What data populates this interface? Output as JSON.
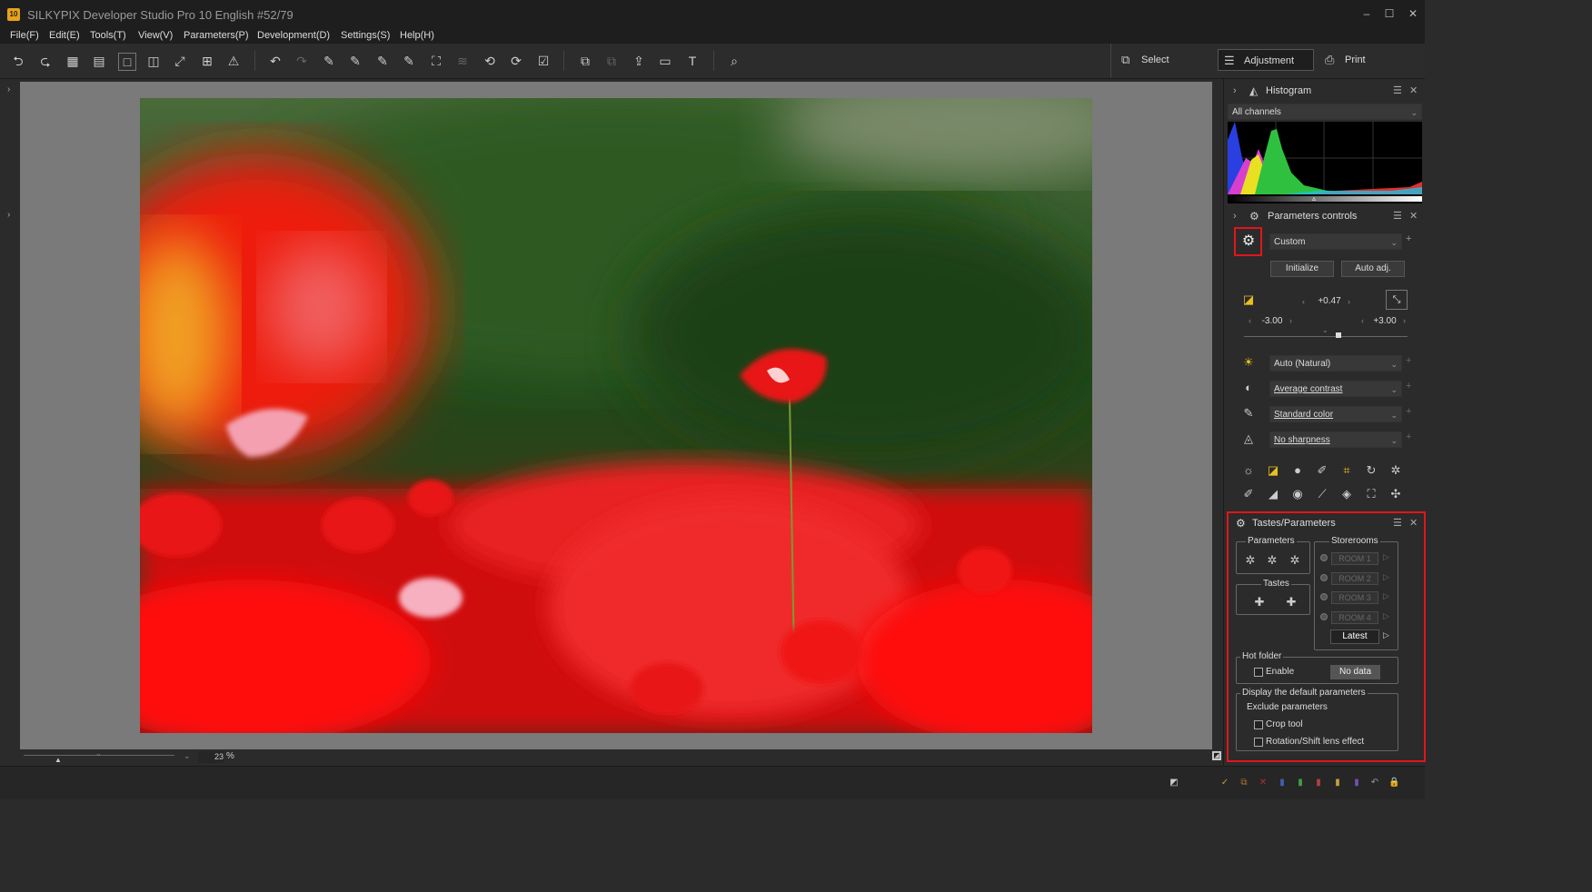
{
  "window": {
    "logo_text": "10",
    "title": "SILKYPIX Developer Studio Pro 10 English   #52/79",
    "minimize": "–",
    "maximize": "☐",
    "close": "✕"
  },
  "menu": [
    "File(F)",
    "Edit(E)",
    "Tools(T)",
    "View(V)",
    "Parameters(P)",
    "Development(D)",
    "Settings(S)",
    "Help(H)"
  ],
  "modes": {
    "select": "Select",
    "adjustment": "Adjustment",
    "print": "Print"
  },
  "zoom": {
    "value": "23",
    "unit": "%"
  },
  "histogram": {
    "title": "Histogram",
    "channel": "All channels"
  },
  "params_controls": {
    "title": "Parameters controls",
    "taste": "Custom",
    "initialize": "Initialize",
    "auto_adj": "Auto adj.",
    "exposure_value": "+0.47",
    "exposure_min": "-3.00",
    "exposure_max": "+3.00",
    "exposure_level": 0.58,
    "white_balance": "Auto (Natural)",
    "contrast": "Average contrast",
    "color": "Standard color",
    "sharpness": "No sharpness"
  },
  "tastes_params": {
    "title": "Tastes/Parameters",
    "parameters_label": "Parameters",
    "storerooms_label": "Storerooms",
    "tastes_label": "Tastes",
    "rooms": [
      "ROOM 1",
      "ROOM 2",
      "ROOM 3",
      "ROOM 4"
    ],
    "latest": "Latest",
    "hot_folder_label": "Hot folder",
    "enable": "Enable",
    "no_data": "No data",
    "display_default_label": "Display the default parameters",
    "exclude_label": "Exclude parameters",
    "crop_tool": "Crop tool",
    "rotation_shift": "Rotation/Shift lens effect"
  },
  "colors": {
    "highlight_box": "#e0161b",
    "accent": "#e8a21b"
  }
}
